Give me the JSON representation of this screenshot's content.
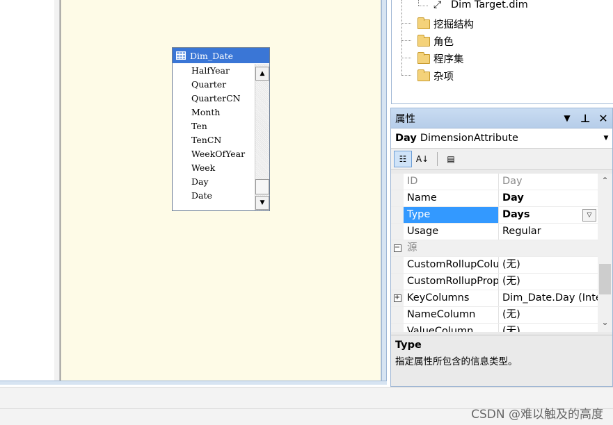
{
  "designer": {
    "table": {
      "name": "Dim_Date",
      "columns": [
        "HalfYear",
        "Quarter",
        "QuarterCN",
        "Month",
        "Ten",
        "TenCN",
        "WeekOfYear",
        "Week",
        "Day",
        "Date"
      ]
    }
  },
  "solution_tree": {
    "items": [
      {
        "label": "Dim Target.dim",
        "icon": "dimension-icon"
      },
      {
        "label": "挖掘结构",
        "icon": "folder-icon"
      },
      {
        "label": "角色",
        "icon": "folder-icon"
      },
      {
        "label": "程序集",
        "icon": "folder-icon"
      },
      {
        "label": "杂项",
        "icon": "folder-icon"
      }
    ]
  },
  "properties": {
    "title": "属性",
    "object_name": "Day",
    "object_type": "DimensionAttribute",
    "rows": [
      {
        "name": "ID",
        "value": "Day"
      },
      {
        "name": "Name",
        "value": "Day"
      },
      {
        "name": "Type",
        "value": "Days"
      },
      {
        "name": "Usage",
        "value": "Regular"
      },
      {
        "name": "源",
        "value": ""
      },
      {
        "name": "CustomRollupColu",
        "value": "(无)"
      },
      {
        "name": "CustomRollupProp",
        "value": "(无)"
      },
      {
        "name": "KeyColumns",
        "value": "Dim_Date.Day (Inte"
      },
      {
        "name": "NameColumn",
        "value": "(无)"
      },
      {
        "name": "ValueColumn",
        "value": "(无)"
      }
    ],
    "description": {
      "title": "Type",
      "text": "指定属性所包含的信息类型。"
    }
  },
  "watermark": "CSDN @难以触及的高度",
  "colors": {
    "designer_bg": "#fefbe7",
    "table_header": "#3a76d6",
    "selection": "#3399ff",
    "panel_title": "#c9dcf2"
  }
}
